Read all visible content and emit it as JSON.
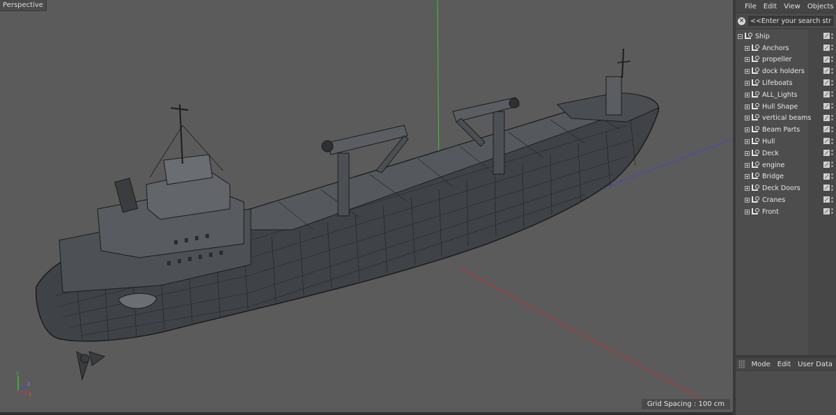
{
  "viewport": {
    "label": "Perspective",
    "grid_spacing": "Grid Spacing : 100 cm",
    "background_color": "#5b5b5b",
    "axis_gizmo": {
      "y": "Y",
      "z": "Z",
      "x": "X"
    }
  },
  "object_manager": {
    "menu": [
      "File",
      "Edit",
      "View",
      "Objects"
    ],
    "search": {
      "placeholder": "<<Enter your search string>>"
    },
    "root": {
      "name": "Ship",
      "expanded": true
    },
    "children": [
      "Anchors",
      "propeller",
      "dock holders",
      "Lifeboats",
      "ALL_Lights",
      "Hull Shape",
      "vertical beams",
      "Beam Parts",
      "Hull",
      "Deck",
      "engine",
      "Bridge",
      "Deck Doors",
      "Cranes",
      "Front"
    ]
  },
  "attribute_manager": {
    "menu": [
      "Mode",
      "Edit",
      "User Data"
    ]
  },
  "colors": {
    "panel_bg": "#4d4d4d",
    "menubar_bg": "#454545",
    "axis_x": "#c83232",
    "axis_y": "#32c832",
    "axis_z": "#3c3cc8"
  }
}
